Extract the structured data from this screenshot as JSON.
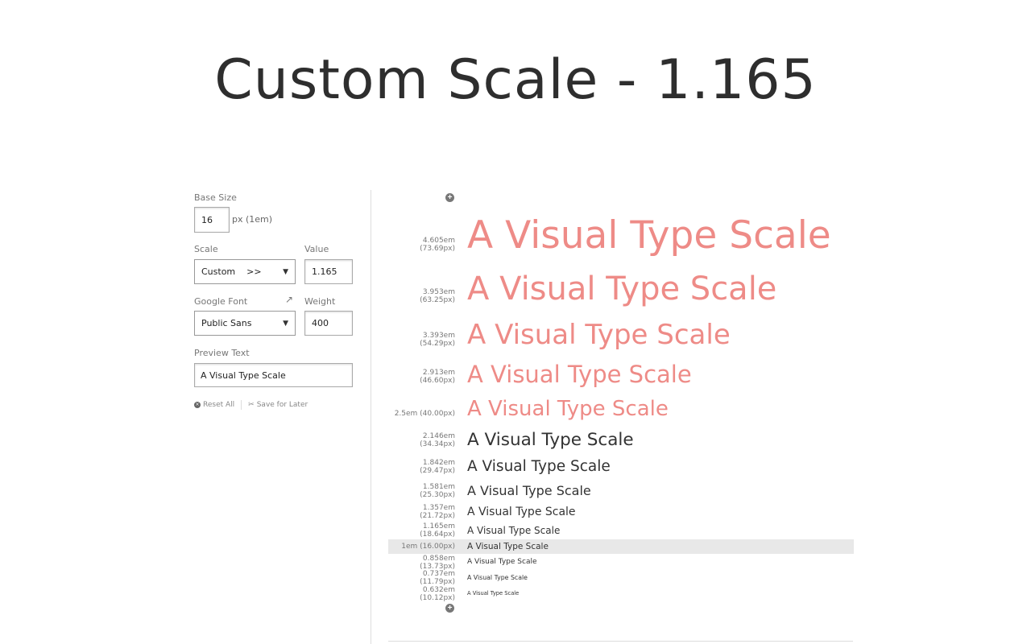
{
  "title": "Custom Scale - 1.165",
  "controls": {
    "base_size_label": "Base Size",
    "base_size_value": "16",
    "base_size_unit": "px (1em)",
    "scale_label": "Scale",
    "scale_value": "Custom",
    "scale_arrows": ">>",
    "value_label": "Value",
    "value_value": "1.165",
    "font_label": "Google Font",
    "font_value": "Public Sans",
    "weight_label": "Weight",
    "weight_value": "400",
    "preview_label": "Preview Text",
    "preview_value": "A Visual Type Scale",
    "reset_label": "Reset All",
    "save_label": "Save for Later"
  },
  "scale_rows": [
    {
      "label": "4.605em (73.69px)",
      "text": "A Visual Type Scale"
    },
    {
      "label": "3.953em (63.25px)",
      "text": "A Visual Type Scale"
    },
    {
      "label": "3.393em (54.29px)",
      "text": "A Visual Type Scale"
    },
    {
      "label": "2.913em (46.60px)",
      "text": "A Visual Type Scale"
    },
    {
      "label": "2.5em (40.00px)",
      "text": "A Visual Type Scale"
    },
    {
      "label": "2.146em (34.34px)",
      "text": "A Visual Type Scale"
    },
    {
      "label": "1.842em (29.47px)",
      "text": "A Visual Type Scale"
    },
    {
      "label": "1.581em (25.30px)",
      "text": "A Visual Type Scale"
    },
    {
      "label": "1.357em (21.72px)",
      "text": "A Visual Type Scale"
    },
    {
      "label": "1.165em (18.64px)",
      "text": "A Visual Type Scale"
    },
    {
      "label": "1em (16.00px)",
      "text": "A Visual Type Scale"
    },
    {
      "label": "0.858em (13.73px)",
      "text": "A Visual Type Scale"
    },
    {
      "label": "0.737em (11.79px)",
      "text": "A Visual Type Scale"
    },
    {
      "label": "0.632em (10.12px)",
      "text": "A Visual Type Scale"
    }
  ],
  "colors": {
    "accent": "#ee8b87",
    "text": "#333333"
  },
  "icons": {
    "add_top": "plus-circle-icon",
    "add_bottom": "plus-circle-icon",
    "external": "external-link-icon"
  }
}
